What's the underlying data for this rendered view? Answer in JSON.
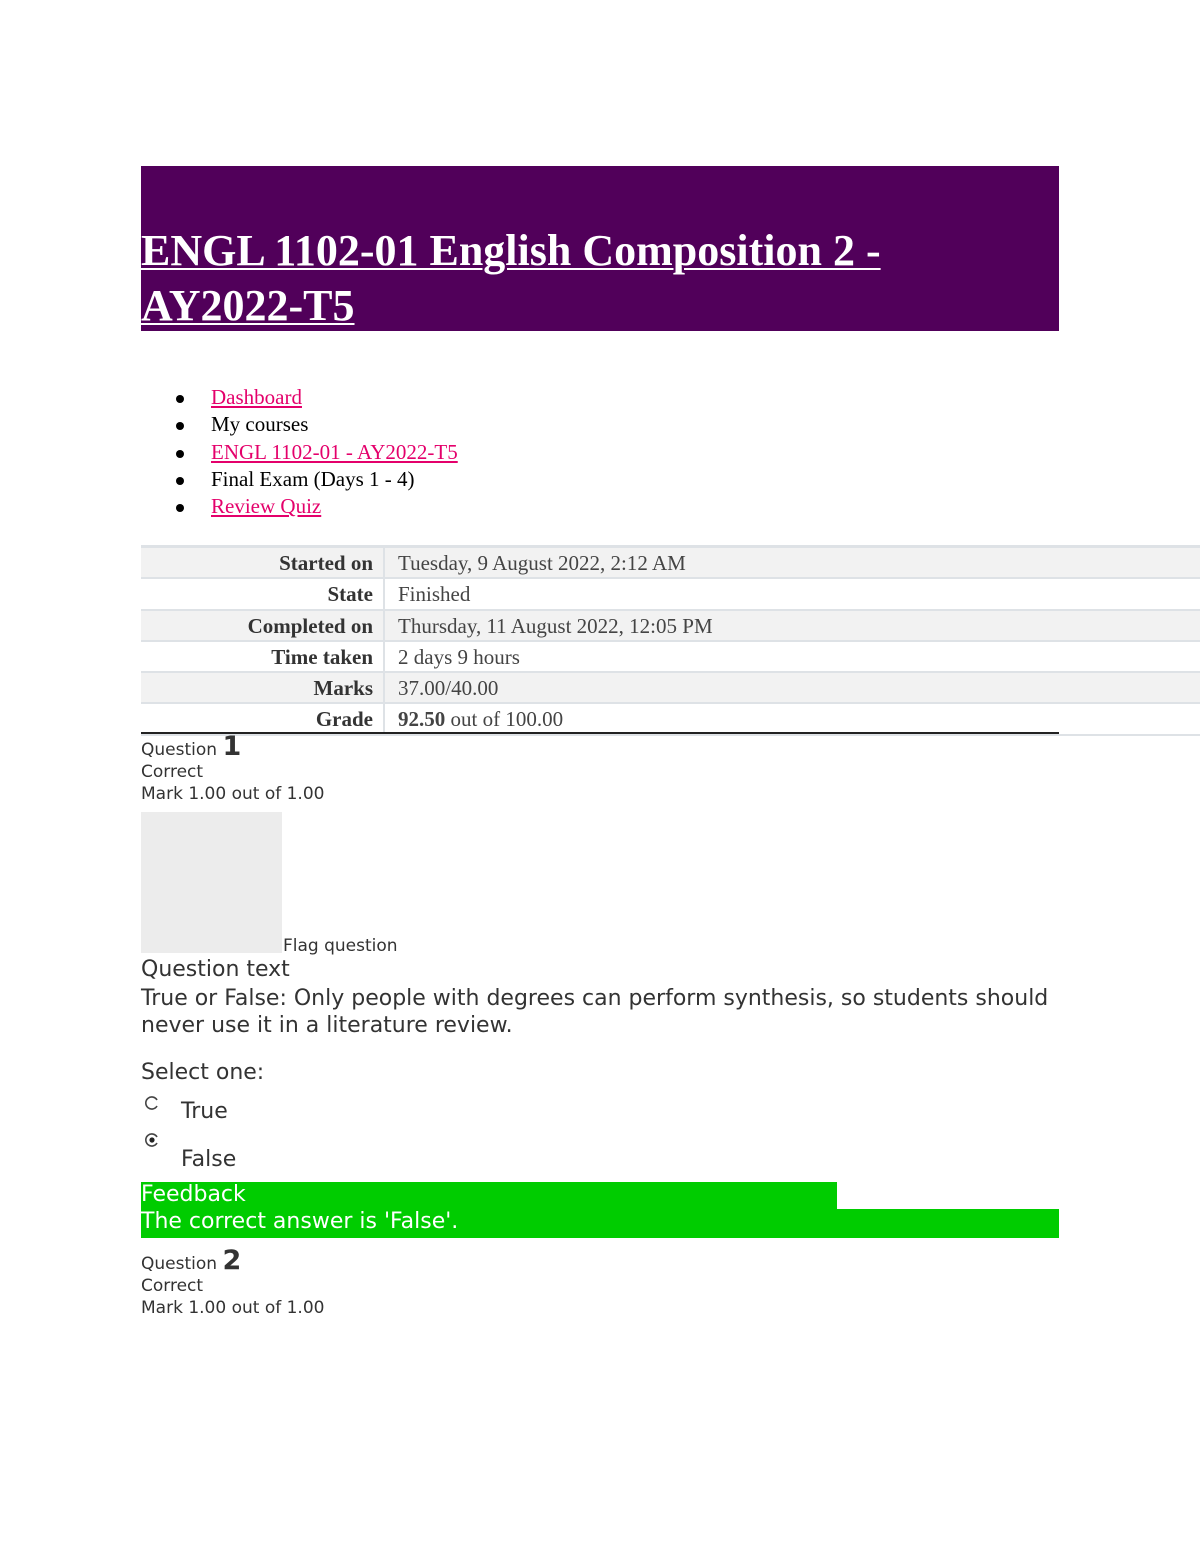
{
  "course": {
    "title": "ENGL 1102-01 English Composition 2 - AY2022-T5"
  },
  "breadcrumb": [
    {
      "label": "Dashboard",
      "link": true
    },
    {
      "label": "My courses",
      "link": false
    },
    {
      "label": "ENGL 1102-01 - AY2022-T5",
      "link": true
    },
    {
      "label": "Final Exam (Days 1 - 4)",
      "link": false
    },
    {
      "label": "Review Quiz",
      "link": true
    }
  ],
  "summary": {
    "started_label": "Started on",
    "started_value": "Tuesday, 9 August 2022, 2:12 AM",
    "state_label": "State",
    "state_value": "Finished",
    "completed_label": "Completed on",
    "completed_value": "Thursday, 11 August 2022, 12:05 PM",
    "time_label": "Time taken",
    "time_value": "2 days 9 hours",
    "marks_label": "Marks",
    "marks_value": "37.00/40.00",
    "grade_label": "Grade",
    "grade_score": "92.50",
    "grade_rest": " out of 100.00"
  },
  "question1": {
    "prefix": "Question",
    "number": "1",
    "status": "Correct",
    "mark": "Mark 1.00 out of 1.00",
    "flag": "Flag question",
    "heading": "Question text",
    "text": "True or False: Only people with degrees can perform synthesis, so students should never use it in a literature review.",
    "select": "Select one:",
    "options": [
      {
        "label": "True",
        "selected": false
      },
      {
        "label": "False",
        "selected": true
      }
    ],
    "feedback_heading": "Feedback",
    "feedback_text": "The correct answer is 'False'."
  },
  "question2": {
    "prefix": "Question",
    "number": "2",
    "status": "Correct",
    "mark": "Mark 1.00 out of 1.00"
  },
  "colors": {
    "banner": "#51005a",
    "link": "#e4006b",
    "feedback": "#00cc00"
  }
}
